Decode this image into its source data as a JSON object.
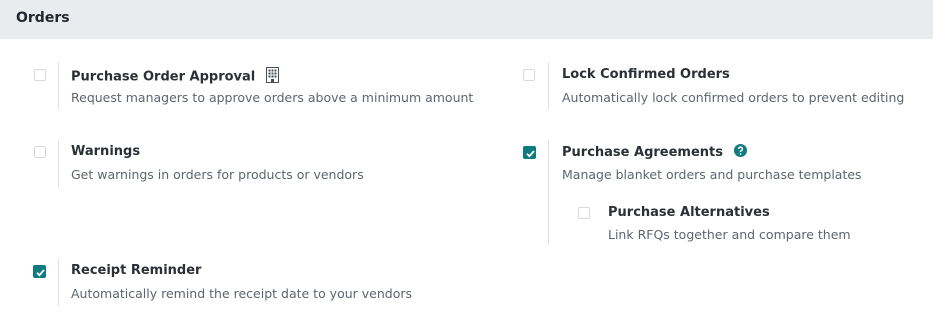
{
  "header": {
    "title": "Orders"
  },
  "settings": {
    "po_approval": {
      "title": "Purchase Order Approval",
      "description": "Request managers to approve orders above a minimum amount",
      "checked": false,
      "icon": "company-building-icon"
    },
    "lock_orders": {
      "title": "Lock Confirmed Orders",
      "description": "Automatically lock confirmed orders to prevent editing",
      "checked": false
    },
    "warnings": {
      "title": "Warnings",
      "description": "Get warnings in orders for products or vendors",
      "checked": false
    },
    "purchase_agreements": {
      "title": "Purchase Agreements",
      "description": "Manage blanket orders and purchase templates",
      "checked": true,
      "icon": "help-question-icon"
    },
    "purchase_alternatives": {
      "title": "Purchase Alternatives",
      "description": "Link RFQs together and compare them",
      "checked": false
    },
    "receipt_reminder": {
      "title": "Receipt Reminder",
      "description": "Automatically remind the receipt date to your vendors",
      "checked": true
    }
  },
  "colors": {
    "accent": "#0f7a80",
    "header_bg": "#e9ecef"
  }
}
